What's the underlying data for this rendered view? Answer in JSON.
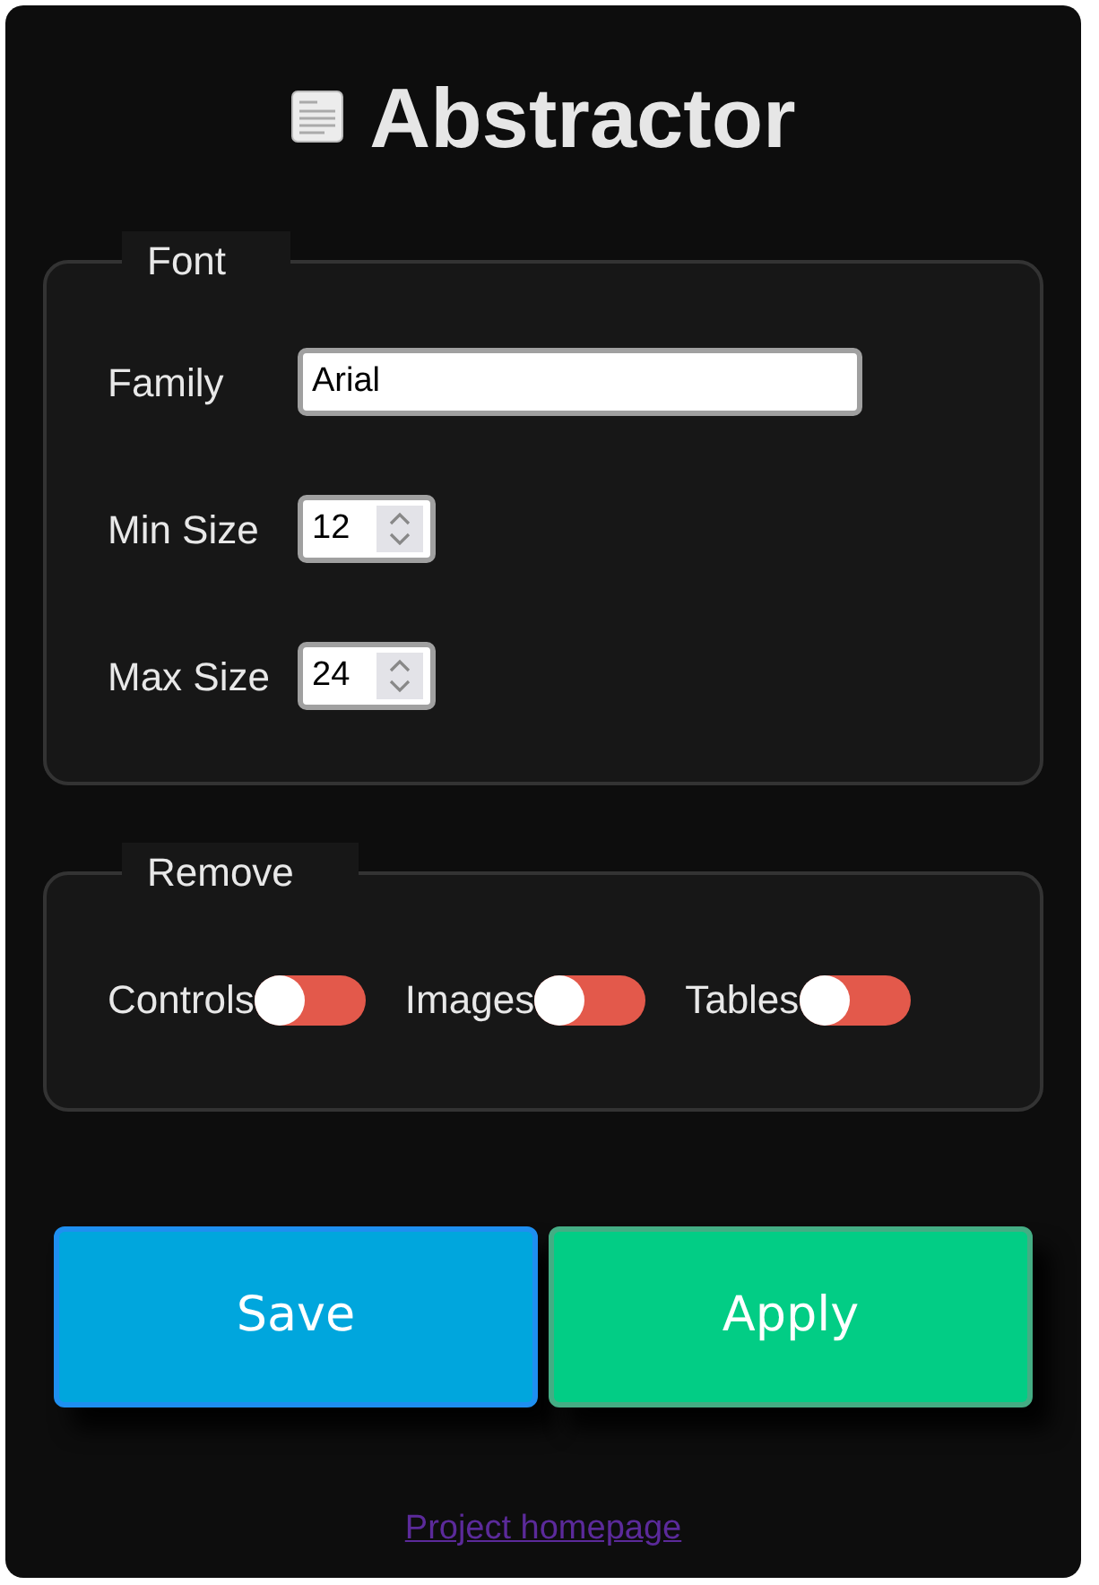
{
  "title": "Abstractor",
  "font_section": {
    "legend": "Font",
    "family": {
      "label": "Family",
      "value": "Arial"
    },
    "min_size": {
      "label": "Min Size",
      "value": "12"
    },
    "max_size": {
      "label": "Max Size",
      "value": "24"
    }
  },
  "remove_section": {
    "legend": "Remove",
    "toggles": [
      {
        "label": "Controls",
        "on": false
      },
      {
        "label": "Images",
        "on": false
      },
      {
        "label": "Tables",
        "on": false
      }
    ]
  },
  "buttons": [
    {
      "label": "Save",
      "kind": "save"
    },
    {
      "label": "Apply",
      "kind": "apply"
    }
  ],
  "link": "Project homepage"
}
